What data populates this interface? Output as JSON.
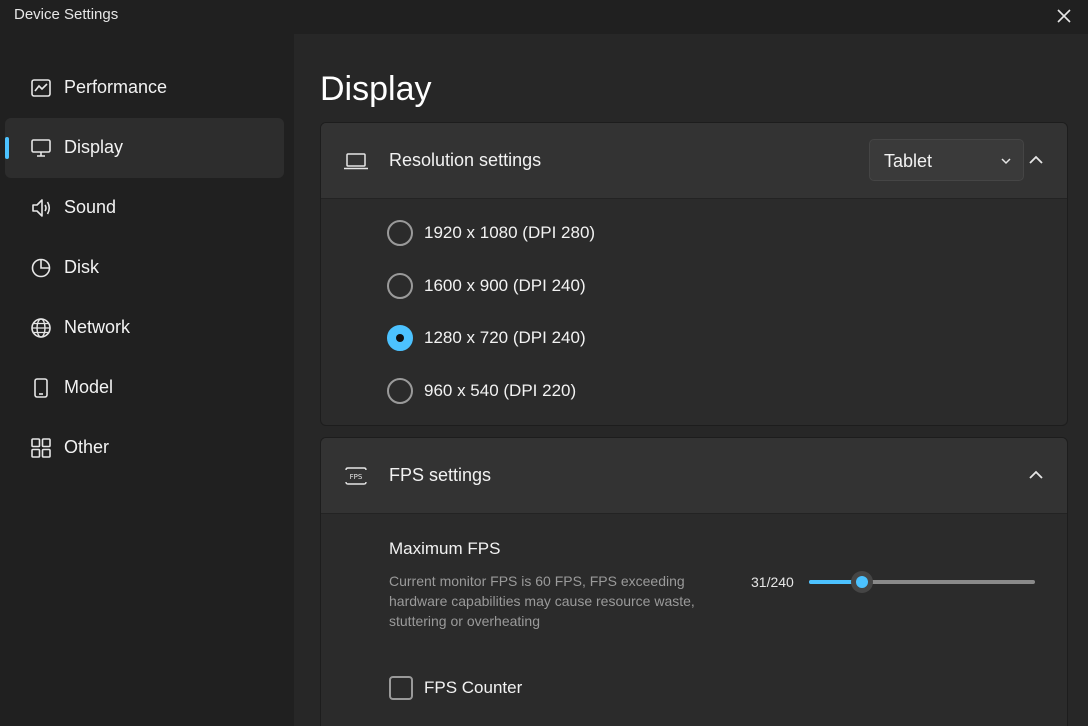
{
  "window": {
    "title": "Device Settings"
  },
  "sidebar": {
    "items": [
      {
        "label": "Performance",
        "icon": "performance-chart-icon",
        "active": false
      },
      {
        "label": "Display",
        "icon": "monitor-icon",
        "active": true
      },
      {
        "label": "Sound",
        "icon": "speaker-icon",
        "active": false
      },
      {
        "label": "Disk",
        "icon": "pie-chart-icon",
        "active": false
      },
      {
        "label": "Network",
        "icon": "globe-icon",
        "active": false
      },
      {
        "label": "Model",
        "icon": "phone-icon",
        "active": false
      },
      {
        "label": "Other",
        "icon": "grid-icon",
        "active": false
      }
    ]
  },
  "main": {
    "title": "Display",
    "resolution": {
      "label": "Resolution settings",
      "icon": "laptop-icon",
      "dropdown_value": "Tablet",
      "options": [
        {
          "label": "1920 x 1080 (DPI 280)",
          "selected": false
        },
        {
          "label": "1600 x 900 (DPI 240)",
          "selected": false
        },
        {
          "label": "1280 x 720 (DPI 240)",
          "selected": true
        },
        {
          "label": "960 x 540 (DPI 220)",
          "selected": false
        }
      ]
    },
    "fps": {
      "label": "FPS settings",
      "icon": "fps-icon",
      "max_label": "Maximum FPS",
      "description": "Current monitor FPS is 60 FPS, FPS exceeding hardware capabilities may cause resource waste, stuttering or overheating",
      "slider_text": "31/240",
      "slider_value": 31,
      "slider_max": 240,
      "counter_label": "FPS Counter",
      "counter_checked": false
    }
  },
  "colors": {
    "accent": "#4cc2ff",
    "sidebar_bg": "#202020",
    "content_bg": "#272727",
    "card_header_bg": "#333333"
  }
}
